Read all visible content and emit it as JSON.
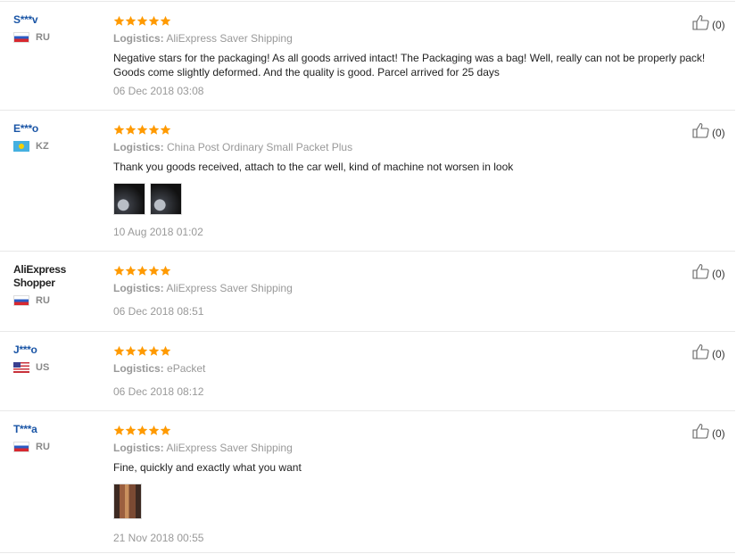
{
  "colors": {
    "star": "#ff9a00",
    "username": "#1a55a6",
    "muted": "#999999"
  },
  "labels": {
    "logistics": "Logistics:"
  },
  "reviews": [
    {
      "user": "S***v",
      "country": "RU",
      "rating": 5,
      "logistics": "AliExpress Saver Shipping",
      "text": "Negative stars for the packaging! As all goods arrived intact! The Packaging was a bag! Well, really can not be properly pack! Goods come slightly deformed. And the quality is good. Parcel arrived for 25 days",
      "date": "06 Dec 2018 03:08",
      "likes": "(0)",
      "photos": 0
    },
    {
      "user": "E***o",
      "country": "KZ",
      "rating": 5,
      "logistics": "China Post Ordinary Small Packet Plus",
      "text": "Thank you goods received, attach to the car well, kind of machine not worsen in look",
      "date": "10 Aug 2018 01:02",
      "likes": "(0)",
      "photos": 2
    },
    {
      "user": "AliExpress Shopper",
      "country": "RU",
      "rating": 5,
      "logistics": "AliExpress Saver Shipping",
      "text": "",
      "date": "06 Dec 2018 08:51",
      "likes": "(0)",
      "photos": 0
    },
    {
      "user": "J***o",
      "country": "US",
      "rating": 5,
      "logistics": "ePacket",
      "text": "",
      "date": "06 Dec 2018 08:12",
      "likes": "(0)",
      "photos": 0
    },
    {
      "user": "T***a",
      "country": "RU",
      "rating": 5,
      "logistics": "AliExpress Saver Shipping",
      "text": "Fine, quickly and exactly what you want",
      "date": "21 Nov 2018 00:55",
      "likes": "(0)",
      "photos": 1
    }
  ]
}
